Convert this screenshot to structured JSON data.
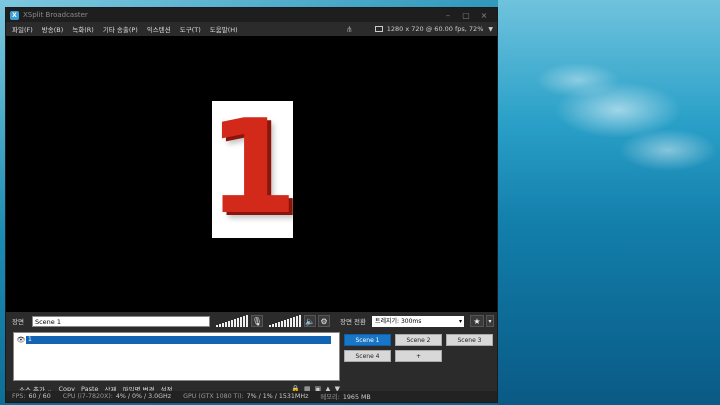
{
  "window": {
    "title": "XSplit Broadcaster",
    "app_icon": "X",
    "minimize": "–",
    "maximize": "▢",
    "close": "×"
  },
  "menu": {
    "items": [
      "파일(F)",
      "방송(B)",
      "녹화(R)",
      "기타 송출(P)",
      "익스텐션",
      "도구(T)",
      "도움말(H)"
    ],
    "share_icon": "share-icon",
    "resolution": "1280 x 720 @ 60.00 fps, 72%",
    "caret": "▼"
  },
  "preview": {
    "source_glyph": "1"
  },
  "scene_bar": {
    "scene_label": "장면",
    "scene_name": "Scene 1",
    "transition_label": "장면 전환",
    "transition_value": "트레지기: 300ms",
    "dropdown": "▾",
    "mic_icon": "🎙",
    "speaker_icon": "🔈",
    "gear_icon": "⚙",
    "star_icon": "★"
  },
  "sources": [
    {
      "visible_icon": "👁",
      "label": "1",
      "selected": true
    }
  ],
  "scenes": [
    {
      "label": "Scene 1",
      "active": true
    },
    {
      "label": "Scene 2",
      "active": false
    },
    {
      "label": "Scene 3",
      "active": false
    },
    {
      "label": "Scene 4",
      "active": false
    },
    {
      "label": "+",
      "active": false
    }
  ],
  "source_toolbar": {
    "add": "소스 추가 ⌄",
    "copy": "Copy",
    "paste": "Paste",
    "delete": "삭제",
    "rename": "파일명 변경",
    "settings": "설정",
    "lock_icon": "🔒",
    "grid_icon": "▦",
    "fit_icon": "▣",
    "up_icon": "▲",
    "down_icon": "▼"
  },
  "status": {
    "fps_label": "FPS:",
    "fps_value": "60 / 60",
    "cpu_label": "CPU (i7-7820X):",
    "cpu_value": "4% / 0% / 3.0GHz",
    "gpu_label": "GPU (GTX 1080 Ti):",
    "gpu_value": "7% / 1% / 1531MHz",
    "mem_label": "메모리:",
    "mem_value": "1965 MB"
  }
}
